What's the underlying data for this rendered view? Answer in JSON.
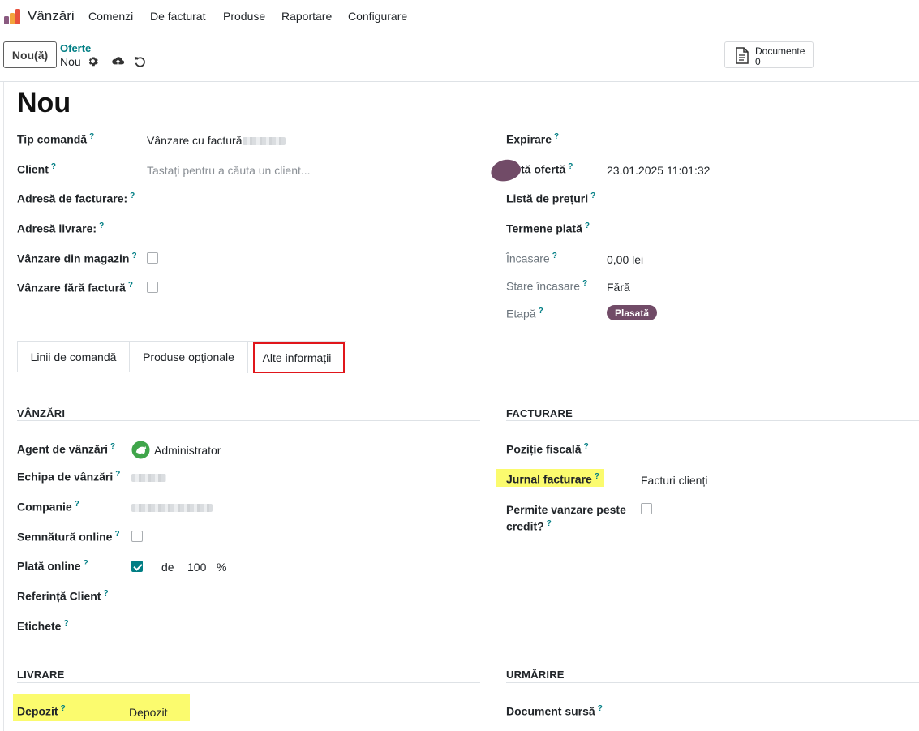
{
  "nav": {
    "app_title": "Vânzări",
    "menu": [
      "Comenzi",
      "De facturat",
      "Produse",
      "Raportare",
      "Configurare"
    ]
  },
  "control": {
    "new_button": "Nou(ă)",
    "breadcrumb_parent": "Oferte",
    "breadcrumb_current": "Nou",
    "documents_label": "Documente",
    "documents_count": "0"
  },
  "form": {
    "title": "Nou",
    "left": {
      "order_type_label": "Tip comandă",
      "order_type_value": "Vânzare cu factură",
      "client_label": "Client",
      "client_placeholder": "Tastați pentru a căuta un client...",
      "invoice_address_label": "Adresă de facturare:",
      "delivery_address_label": "Adresă livrare:",
      "store_sale_label": "Vânzare din magazin",
      "no_invoice_sale_label": "Vânzare fără factură"
    },
    "right": {
      "expiration_label": "Expirare",
      "offer_date_label": "tă ofertă",
      "offer_date_value": "23.01.2025 11:01:32",
      "pricelist_label": "Listă de prețuri",
      "payment_terms_label": "Termene plată",
      "collection_label": "Încasare",
      "collection_value": "0,00 lei",
      "collection_status_label": "Stare încasare",
      "collection_status_value": "Fără",
      "stage_label": "Etapă",
      "stage_value": "Plasată"
    },
    "help_mark": "?"
  },
  "tabs": [
    "Linii de comandă",
    "Produse opționale",
    "Alte informații"
  ],
  "other_info": {
    "sales": {
      "title": "VÂNZĂRI",
      "salesperson_label": "Agent de vânzări",
      "salesperson_value": "Administrator",
      "sales_team_label": "Echipa de vânzări",
      "company_label": "Companie",
      "online_signature_label": "Semnătură online",
      "online_payment_label": "Plată online",
      "online_payment_of": "de",
      "online_payment_percent": "100",
      "percent_sign": "%",
      "customer_ref_label": "Referință Client",
      "tags_label": "Etichete"
    },
    "invoicing": {
      "title": "FACTURARE",
      "fiscal_position_label": "Poziție fiscală",
      "invoice_journal_label": "Jurnal facturare",
      "invoice_journal_value": "Facturi clienți",
      "allow_credit_label_1": "Permite vanzare peste",
      "allow_credit_label_2": "credit?"
    },
    "delivery": {
      "title": "LIVRARE",
      "warehouse_label": "Depozit",
      "warehouse_value": "Depozit"
    },
    "tracking": {
      "title": "URMĂRIRE",
      "source_document_label": "Document sursă"
    }
  },
  "colors": {
    "brand": "#714b67",
    "link": "#017e84",
    "highlight": "#fbfb6e",
    "tab_outline": "#e0161b"
  }
}
